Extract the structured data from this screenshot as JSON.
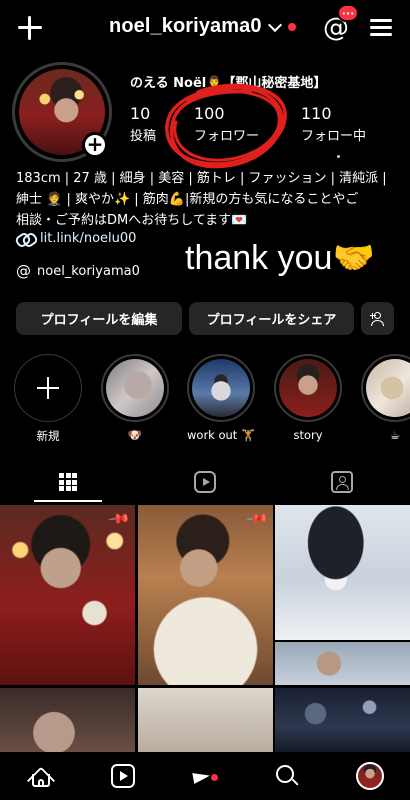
{
  "header": {
    "username": "noel_koriyama0",
    "notification_badge": "···"
  },
  "profile": {
    "display_name": "のえる Noël🤵‍♂️【郡山秘密基地】",
    "stats": [
      {
        "num": "10",
        "label": "投稿"
      },
      {
        "num": "100",
        "label": "フォロワー"
      },
      {
        "num": "110",
        "label": "フォロー中"
      }
    ],
    "bio_lines": [
      "183cm | 27 歳 | 細身 | 美容 | 筋トレ | ファッション | 清純派 |",
      "紳士 🤵 | 爽やか✨ | 筋肉💪|新規の方も気になることやご",
      "相談・ご予約はDMへお待ちしてます💌"
    ],
    "link": "lit.link/noelu00",
    "overlay_text": "thank you🤝",
    "threads_handle": "noel_koriyama0",
    "threads_glyph": "@"
  },
  "actions": {
    "edit_label": "プロフィールを編集",
    "share_label": "プロフィールをシェア"
  },
  "highlights": [
    {
      "label": "新規"
    },
    {
      "label": "🐶"
    },
    {
      "label": "work out 🏋"
    },
    {
      "label": "story"
    },
    {
      "label": "☕"
    }
  ],
  "colors": {
    "background": "#000000",
    "button_bg": "#262626",
    "badge_red": "#ff3040",
    "scribble_red": "#e0201c",
    "link_blue": "#e0f1ff"
  },
  "icons": {
    "pin": "📌"
  }
}
